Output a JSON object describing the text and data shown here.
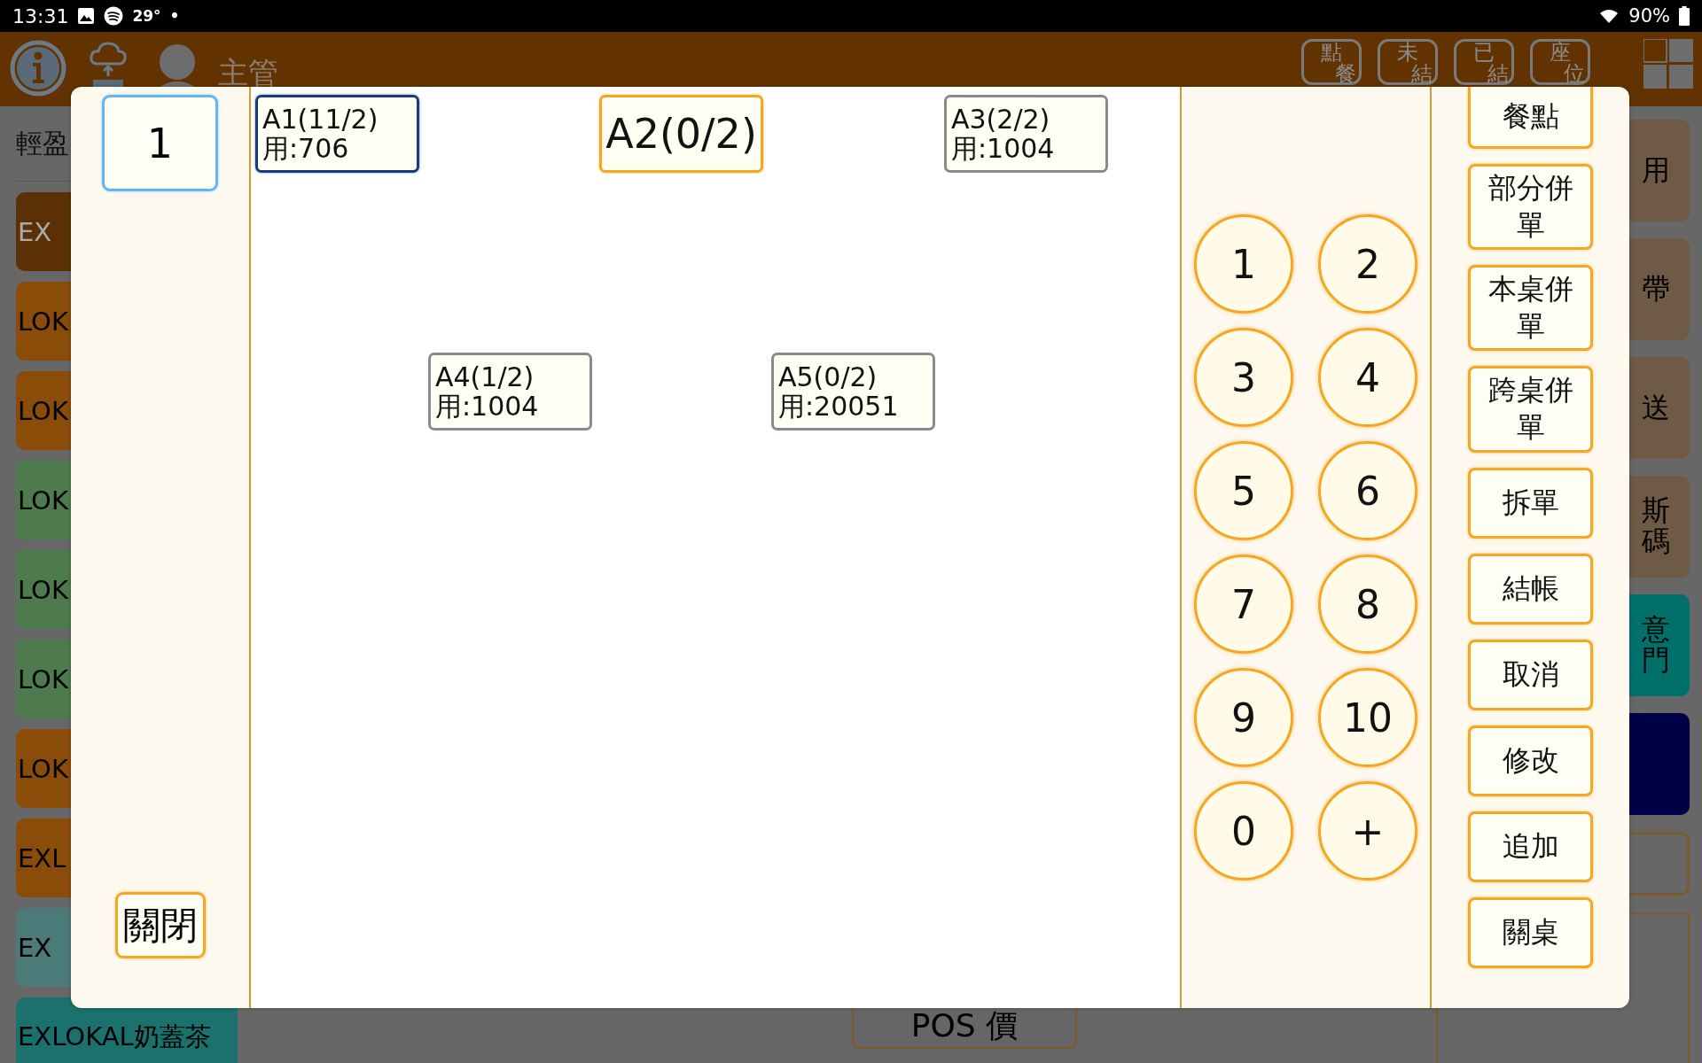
{
  "status_bar": {
    "time": "13:31",
    "temperature": "29°",
    "dot": "•",
    "battery": "90%"
  },
  "header": {
    "role": "主管",
    "nav_buttons": [
      {
        "top": "點",
        "bottom": "餐"
      },
      {
        "top": "未",
        "bottom": "結"
      },
      {
        "top": "已",
        "bottom": "結"
      },
      {
        "top": "座",
        "bottom": "位"
      }
    ]
  },
  "category_panel": {
    "title": "輕盈",
    "items": [
      {
        "label": "EX",
        "color": "#5b3006"
      },
      {
        "label": "LOK",
        "color": "#8a4c08"
      },
      {
        "label": "LOK",
        "color": "#8a4c08"
      },
      {
        "label": "LOK",
        "color": "#4d7b4d"
      },
      {
        "label": "LOK",
        "color": "#4d7b4d"
      },
      {
        "label": "LOK",
        "color": "#4d7b4d"
      },
      {
        "label": "LOK",
        "color": "#8a4c08"
      },
      {
        "label": "EXL",
        "color": "#8a4c08"
      },
      {
        "label": "EX",
        "color": "#4c7a78"
      },
      {
        "label": "EXLOKAL奶蓋茶",
        "color": "#1a716d"
      }
    ]
  },
  "side_buttons": [
    {
      "label": "用",
      "color": "#6f5a45"
    },
    {
      "label": "帶",
      "color": "#6f5a45"
    },
    {
      "label": "送",
      "color": "#6f5a45"
    },
    {
      "label": "斯碼",
      "color": "#6f5a45"
    },
    {
      "label": "意門",
      "color": "#00706b"
    },
    {
      "color": "#000046"
    }
  ],
  "pos_price_button": "POS 價",
  "dialog": {
    "table_number": "1",
    "close_button": "關閉",
    "tables": [
      {
        "name": "A1(11/2)",
        "usage": "用:706",
        "kind": "in-use",
        "selected": true
      },
      {
        "name": "A2(0/2)",
        "kind": "vacant",
        "selected": false
      },
      {
        "name": "A3(2/2)",
        "usage": "用:1004",
        "kind": "in-use",
        "selected": false
      },
      {
        "name": "A4(1/2)",
        "usage": "用:1004",
        "kind": "in-use",
        "selected": false
      },
      {
        "name": "A5(0/2)",
        "usage": "用:20051",
        "kind": "in-use",
        "selected": false
      }
    ],
    "keypad": [
      "1",
      "2",
      "3",
      "4",
      "5",
      "6",
      "7",
      "8",
      "9",
      "10",
      "0",
      "+"
    ],
    "actions": [
      "餐點",
      "部分併單",
      "本桌併單",
      "跨桌併單",
      "拆單",
      "結帳",
      "取消",
      "修改",
      "追加",
      "關桌"
    ]
  }
}
